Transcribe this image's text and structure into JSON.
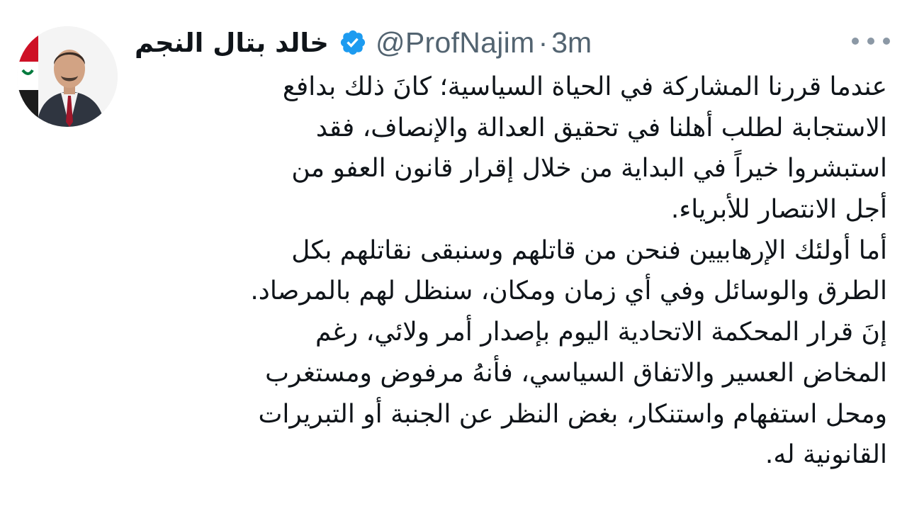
{
  "tweet": {
    "author": {
      "display_name": "خالد بتال النجم",
      "verified_icon": "verified-badge-icon",
      "handle": "@ProfNajim",
      "separator": "·",
      "time": "3m"
    },
    "more_icon": "more-options-icon",
    "body_lines": [
      "عندما قررنا المشاركة في الحياة السياسية؛ كانَ ذلك بدافع",
      "الاستجابة لطلب أهلنا في تحقيق العدالة والإنصاف، فقد",
      "استبشروا خيراً في البداية من خلال إقرار قانون العفو من",
      "أجل الانتصار للأبرياء.",
      "أما أولئك الإرهابيين فنحن من قاتلهم وسنبقى نقاتلهم بكل",
      "الطرق والوسائل وفي أي زمان ومكان، سنظل لهم بالمرصاد.",
      "إنَ قرار المحكمة الاتحادية اليوم بإصدار أمر ولائي، رغم",
      "المخاض العسير والاتفاق السياسي، فأنهُ مرفوض ومستغرب",
      "ومحل استفهام واستنكار، بغض النظر عن الجنبة أو التبريرات",
      "القانونية له."
    ],
    "colors": {
      "text": "#0f1419",
      "secondary": "#536471",
      "verified": "#1d9bf0"
    }
  }
}
